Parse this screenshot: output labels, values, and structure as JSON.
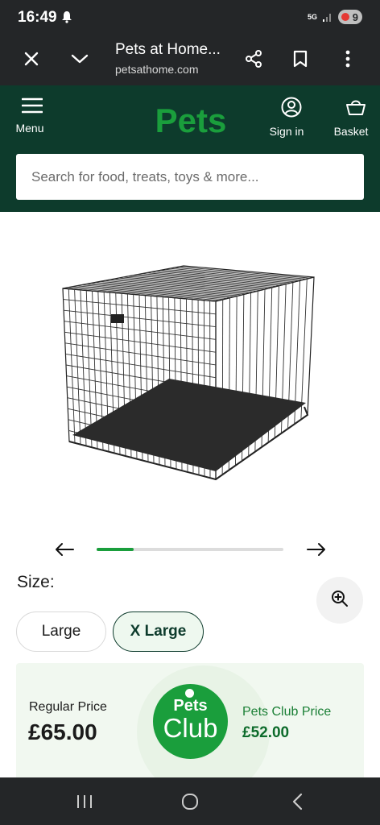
{
  "status_bar": {
    "time": "16:49",
    "network": "5G",
    "battery_level": "9"
  },
  "browser": {
    "page_title": "Pets at Home...",
    "url": "petsathome.com"
  },
  "header": {
    "logo_text": "Pets",
    "menu_label": "Menu",
    "sign_in_label": "Sign in",
    "basket_label": "Basket",
    "brand_color": "#0d3b2c",
    "accent_color": "#1a9e3c",
    "search_placeholder": "Search for food, treats, toys & more..."
  },
  "product": {
    "image_icon": "dog-crate-image",
    "carousel_progress": 0.2
  },
  "size": {
    "label": "Size:",
    "options": [
      "Large",
      "X Large"
    ],
    "selected": "X Large"
  },
  "pricing": {
    "regular_label": "Regular Price",
    "regular_price": "£65.00",
    "club_logo_line1": "Pets",
    "club_logo_line2": "Club",
    "club_label": "Pets Club Price",
    "club_price": "£52.00"
  }
}
